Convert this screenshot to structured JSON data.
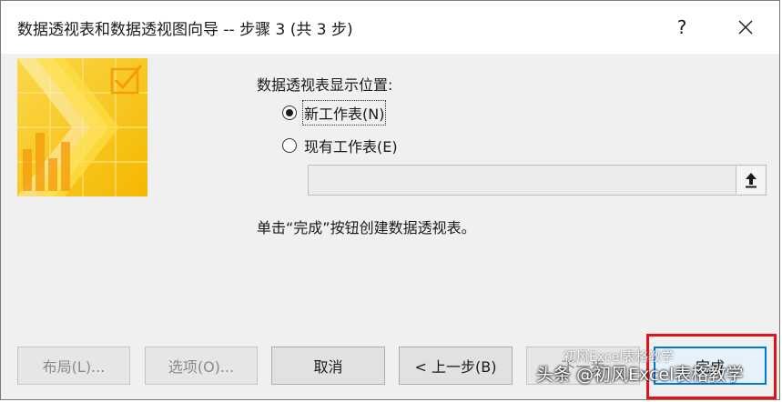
{
  "window": {
    "title": "数据透视表和数据透视图向导 -- 步骤 3 (共 3 步)",
    "help_label": "?",
    "close_label": "✕"
  },
  "section": {
    "label": "数据透视表显示位置:"
  },
  "options": {
    "new_sheet": "新工作表(N)",
    "existing_sheet": "现有工作表(E)",
    "selected": "new_sheet"
  },
  "range": {
    "value": ""
  },
  "hint": "单击“完成”按钮创建数据透视表。",
  "buttons": {
    "layout": "布局(L)...",
    "options": "选项(O)...",
    "cancel": "取消",
    "back": "< 上一步(B)",
    "next": "下一步",
    "finish": "完成"
  },
  "watermark": {
    "line1": "初风Excel表格教学",
    "line2": "头条 @初风Excel表格教学"
  },
  "colors": {
    "accent": "#0078d7",
    "highlight": "#e8111a",
    "wizard_yellow": "#f7c81b"
  }
}
